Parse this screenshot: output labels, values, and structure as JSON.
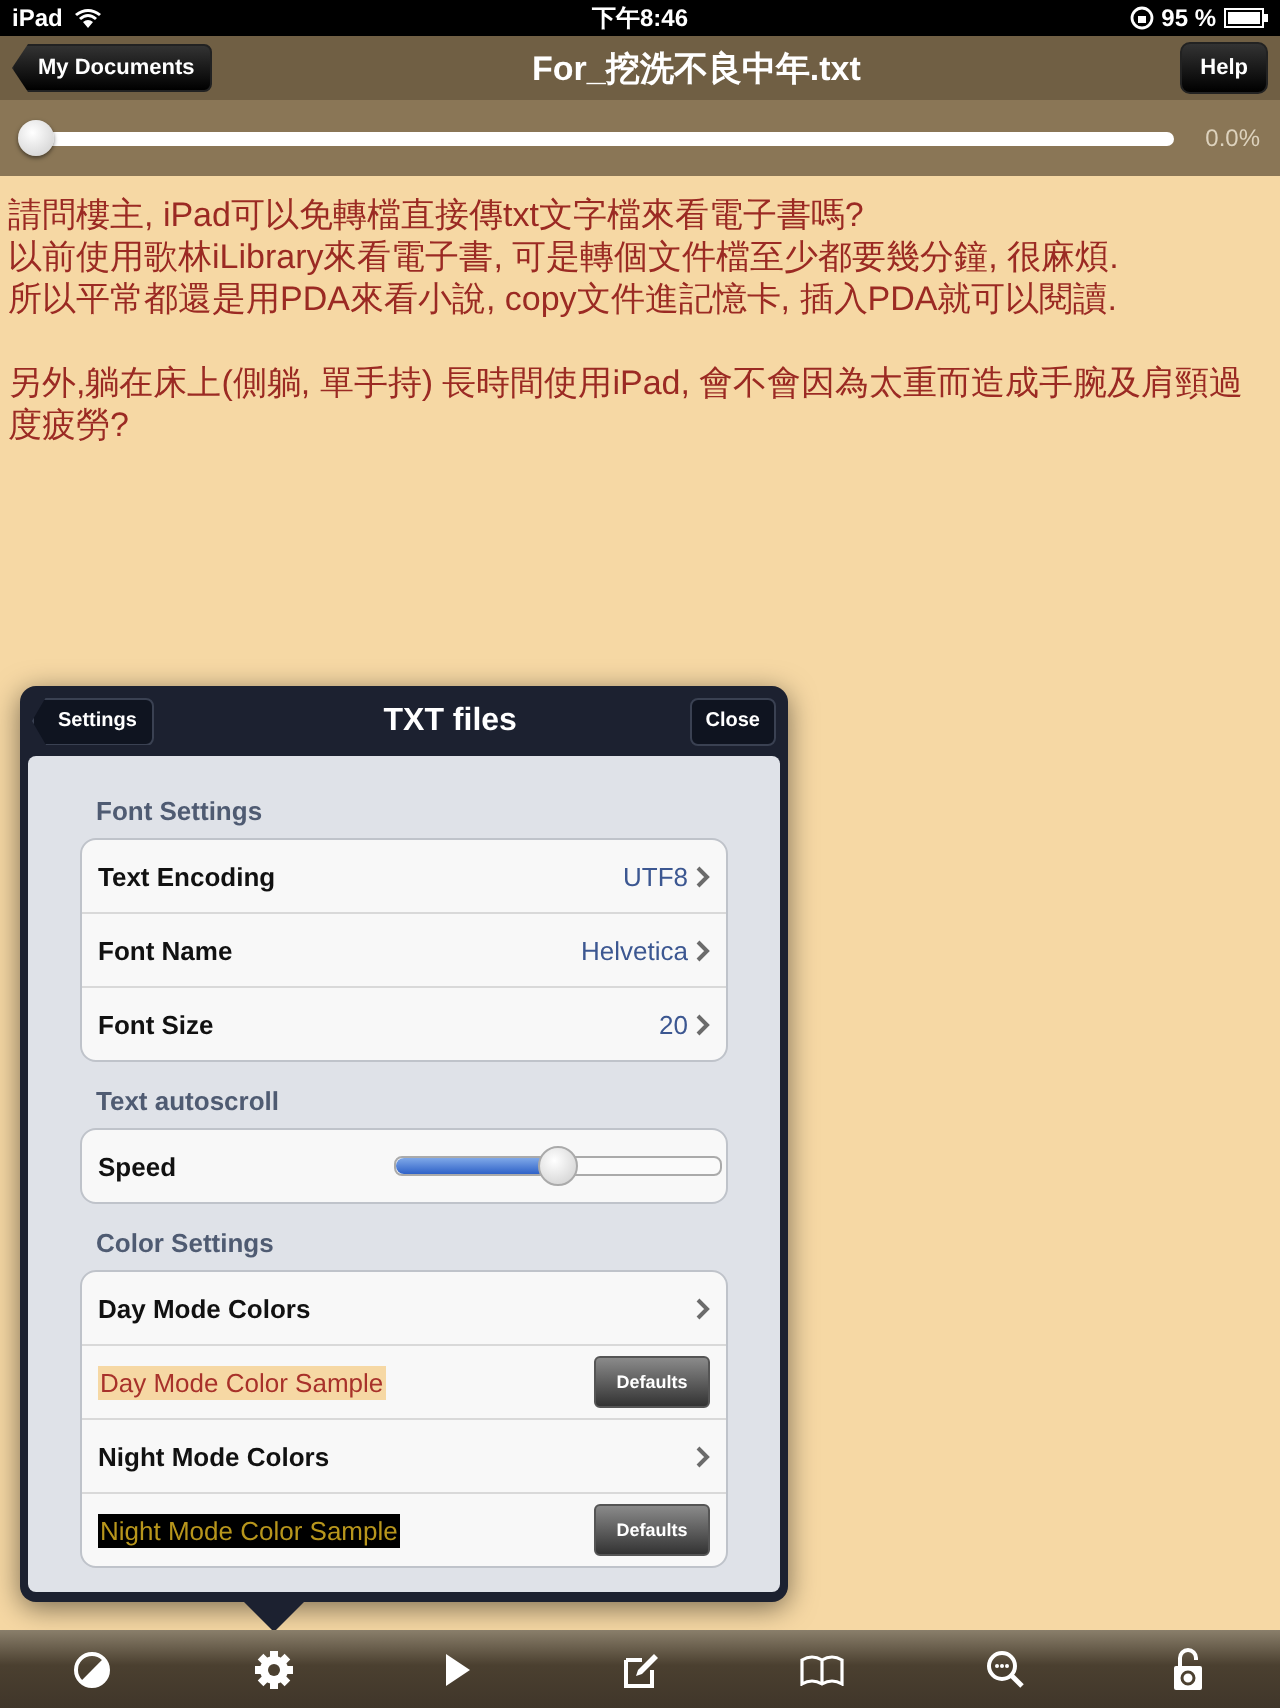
{
  "status_bar": {
    "carrier": "iPad",
    "time": "下午8:46",
    "battery": "95 %"
  },
  "nav_bar": {
    "back": "My Documents",
    "title": "For_挖洗不良中年.txt",
    "help": "Help"
  },
  "progress": {
    "level": 0,
    "reading": "0.0%"
  },
  "document": {
    "paragraphs": [
      {
        "lines": [
          "請問樓主, iPad可以免轉檔直接傳txt文字檔來看電子書嗎?",
          "以前使用歌林iLibrary來看電子書, 可是轉個文件檔至少都要幾分鐘, 很麻煩.",
          "所以平常都還是用PDA來看小說, copy文件進記憶卡, 插入PDA就可以閱讀."
        ]
      },
      {
        "lines": [
          "另外,躺在床上(側躺, 單手持) 長時間使用iPad, 會不會因為太重而造成手腕及肩頸過",
          "度疲勞?"
        ]
      }
    ]
  },
  "popover": {
    "back": "Settings",
    "title": "TXT files",
    "close": "Close",
    "sections": [
      {
        "header": "Font Settings",
        "rows": [
          {
            "kind": "value",
            "label": "Text Encoding",
            "value": "UTF8"
          },
          {
            "kind": "value",
            "label": "Font Name",
            "value": "Helvetica"
          },
          {
            "kind": "value",
            "label": "Font Size",
            "value": "20"
          }
        ]
      },
      {
        "header": "Text autoscroll",
        "rows": [
          {
            "kind": "slider",
            "label": "Speed",
            "level": 0.5
          }
        ]
      },
      {
        "header": "Color Settings",
        "rows": [
          {
            "kind": "link",
            "label": "Day Mode Colors"
          },
          {
            "kind": "day_sample",
            "label": "Day Mode Color Sample",
            "button": "Defaults"
          },
          {
            "kind": "link",
            "label": "Night Mode Colors"
          },
          {
            "kind": "night_sample",
            "label": "Night Mode Color Sample",
            "button": "Defaults"
          }
        ]
      }
    ]
  }
}
